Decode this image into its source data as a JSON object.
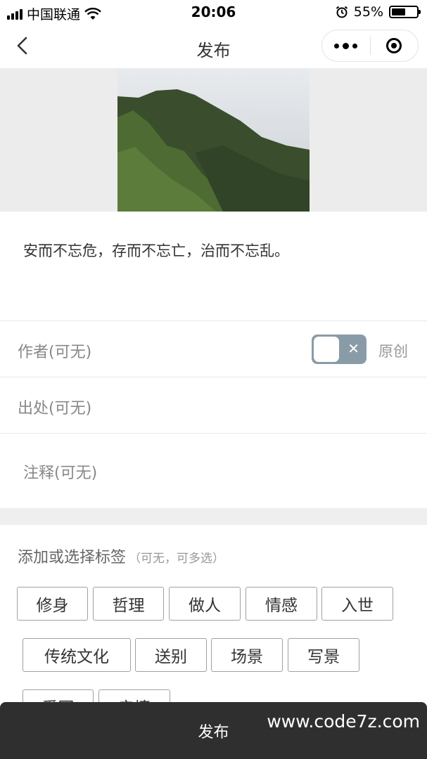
{
  "status_bar": {
    "carrier": "中国联通",
    "time": "20:06",
    "battery": "55%",
    "battery_level": 0.55
  },
  "nav": {
    "title": "发布"
  },
  "quote": "安而不忘危，存而不忘亡，治而不忘乱。",
  "fields": {
    "author_placeholder": "作者(可无)",
    "original_label": "原创",
    "source_placeholder": "出处(可无)",
    "note_placeholder": "注释(可无)"
  },
  "tags_section": {
    "title": "添加或选择标签",
    "hint": "（可无，可多选）",
    "tags": [
      "修身",
      "哲理",
      "做人",
      "情感",
      "入世",
      "传统文化",
      "送别",
      "场景",
      "写景",
      "爱国",
      "亲情"
    ]
  },
  "publish_button": "发布",
  "watermark": "www.code7z.com",
  "colors": {
    "toggle_off": "#8a9ba8",
    "publish_bar": "#2f2f2f",
    "divider_band": "#efefef"
  }
}
